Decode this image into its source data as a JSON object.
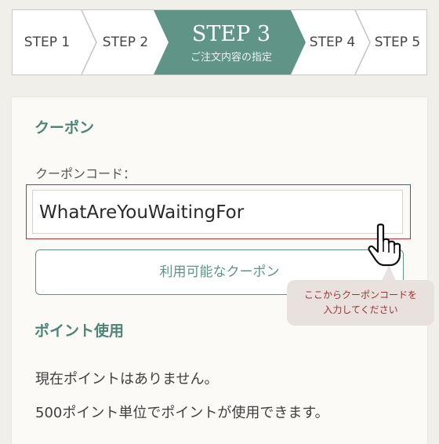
{
  "steps": {
    "step1": "STEP 1",
    "step2": "STEP 2",
    "step3_title": "STEP 3",
    "step3_sub": "ご注文内容の指定",
    "step4": "STEP 4",
    "step5": "STEP 5",
    "active_color": "#5f9487"
  },
  "coupon": {
    "heading": "クーポン",
    "code_label": "クーポンコード：",
    "code_value": "WhatAreYouWaitingFor",
    "available_button": "利用可能なクーポン"
  },
  "tooltip": {
    "line1": "ここからクーポンコードを",
    "line2": "入力してください"
  },
  "points": {
    "heading": "ポイント使用",
    "no_points": "現在ポイントはありません。",
    "unit_note": "500ポイント単位でポイントが使用できます。"
  },
  "colors": {
    "accent": "#5f9487",
    "highlight_border": "#b83232",
    "background": "#f1efe9"
  },
  "icons": {
    "cursor": "hand-pointer-icon"
  }
}
